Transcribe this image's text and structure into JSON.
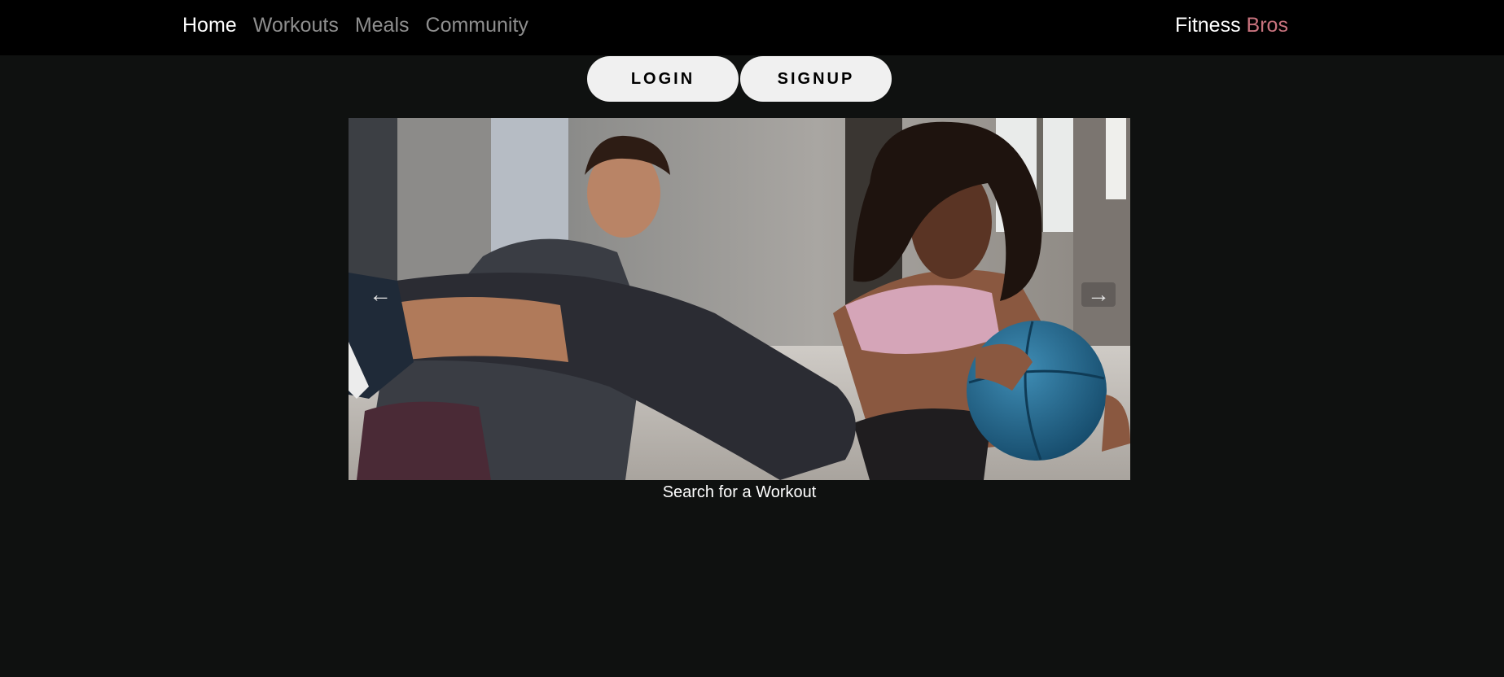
{
  "nav": {
    "items": [
      {
        "label": "Home",
        "active": true
      },
      {
        "label": "Workouts",
        "active": false
      },
      {
        "label": "Meals",
        "active": false
      },
      {
        "label": "Community",
        "active": false
      }
    ],
    "brand": {
      "first": "Fitness",
      "second": "Bros"
    }
  },
  "auth": {
    "login_label": "LOGIN",
    "signup_label": "SIGNUP"
  },
  "carousel": {
    "prev_icon": "←",
    "next_icon": "→",
    "caption": "Search for a Workout"
  },
  "colors": {
    "page_background": "#0f1110",
    "navbar_background": "#000000",
    "nav_active": "#ffffff",
    "nav_inactive": "#8e8e8e",
    "brand_accent": "#c9737e",
    "button_background": "#f0f0f0"
  }
}
